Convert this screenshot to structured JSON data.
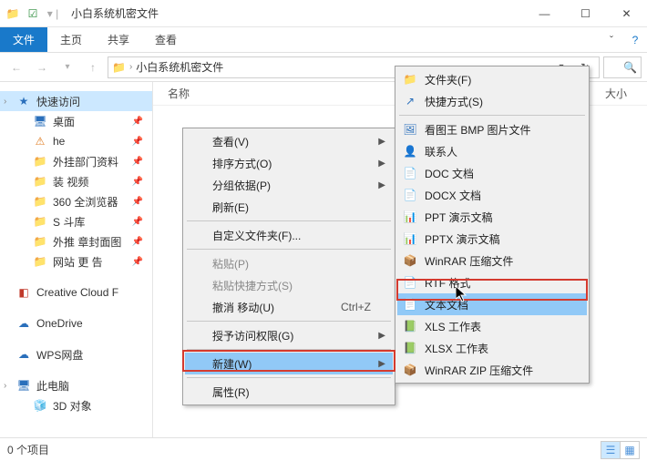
{
  "window": {
    "title": "小白系统机密文件",
    "min": "—",
    "max": "☐",
    "close": "✕"
  },
  "ribbon": {
    "file": "文件",
    "tabs": [
      "主页",
      "共享",
      "查看"
    ]
  },
  "address": {
    "crumb": "小白系统机密文件"
  },
  "columns": {
    "name": "名称",
    "size": "大小"
  },
  "sidebar": {
    "quick": "快速访问",
    "items": [
      {
        "label": "桌面",
        "icon": "🖥",
        "cls": "ic-blue"
      },
      {
        "label": "he",
        "icon": "⚠",
        "cls": "ic-orange"
      },
      {
        "label": "外挂部门资料",
        "icon": "📁",
        "cls": "ic-folder"
      },
      {
        "label": "装   视频",
        "icon": "📁",
        "cls": "ic-folder"
      },
      {
        "label": "360  全浏览器",
        "icon": "📁",
        "cls": "ic-folder"
      },
      {
        "label": "S          斗库",
        "icon": "📁",
        "cls": "ic-folder"
      },
      {
        "label": "外推 章封面图",
        "icon": "📁",
        "cls": "ic-folder"
      },
      {
        "label": "网站   更  告",
        "icon": "📁",
        "cls": "ic-folder"
      }
    ],
    "creative": "Creative Cloud F",
    "onedrive": "OneDrive",
    "wps": "WPS网盘",
    "thispc": "此电脑",
    "obj3d": "3D 对象"
  },
  "status": {
    "count": "0 个项目"
  },
  "menu1": {
    "items": [
      {
        "label": "查看(V)",
        "arrow": true
      },
      {
        "label": "排序方式(O)",
        "arrow": true
      },
      {
        "label": "分组依据(P)",
        "arrow": true
      },
      {
        "label": "刷新(E)"
      }
    ],
    "items2": [
      {
        "label": "自定义文件夹(F)..."
      }
    ],
    "items3": [
      {
        "label": "粘贴(P)",
        "disabled": true
      },
      {
        "label": "粘贴快捷方式(S)",
        "disabled": true
      },
      {
        "label": "撤消 移动(U)",
        "shortcut": "Ctrl+Z"
      }
    ],
    "items4": [
      {
        "label": "授予访问权限(G)",
        "arrow": true
      }
    ],
    "items5": [
      {
        "label": "新建(W)",
        "arrow": true,
        "hover": true
      }
    ],
    "items6": [
      {
        "label": "属性(R)"
      }
    ]
  },
  "menu2": {
    "group1": [
      {
        "label": "文件夹(F)",
        "icon": "📁",
        "cls": "ic-folder"
      },
      {
        "label": "快捷方式(S)",
        "icon": "↗",
        "cls": "ic-blue"
      }
    ],
    "group2": [
      {
        "label": "看图王 BMP 图片文件",
        "icon": "🖼",
        "cls": "ic-blue"
      },
      {
        "label": "联系人",
        "icon": "👤",
        "cls": "ic-dark"
      },
      {
        "label": "DOC 文档",
        "icon": "📄",
        "cls": "ic-blue"
      },
      {
        "label": "DOCX 文档",
        "icon": "📄",
        "cls": "ic-blue"
      },
      {
        "label": "PPT 演示文稿",
        "icon": "📊",
        "cls": "ic-red"
      },
      {
        "label": "PPTX 演示文稿",
        "icon": "📊",
        "cls": "ic-red"
      },
      {
        "label": "WinRAR 压缩文件",
        "icon": "📦",
        "cls": "ic-purple"
      },
      {
        "label": "RTF 格式",
        "icon": "📄",
        "cls": "ic-blue"
      },
      {
        "label": "文本文档",
        "icon": "📄",
        "cls": "ic-dark",
        "hover": true
      },
      {
        "label": "XLS 工作表",
        "icon": "📗",
        "cls": "ic-green"
      },
      {
        "label": "XLSX 工作表",
        "icon": "📗",
        "cls": "ic-green"
      },
      {
        "label": "WinRAR ZIP 压缩文件",
        "icon": "📦",
        "cls": "ic-purple"
      }
    ]
  }
}
